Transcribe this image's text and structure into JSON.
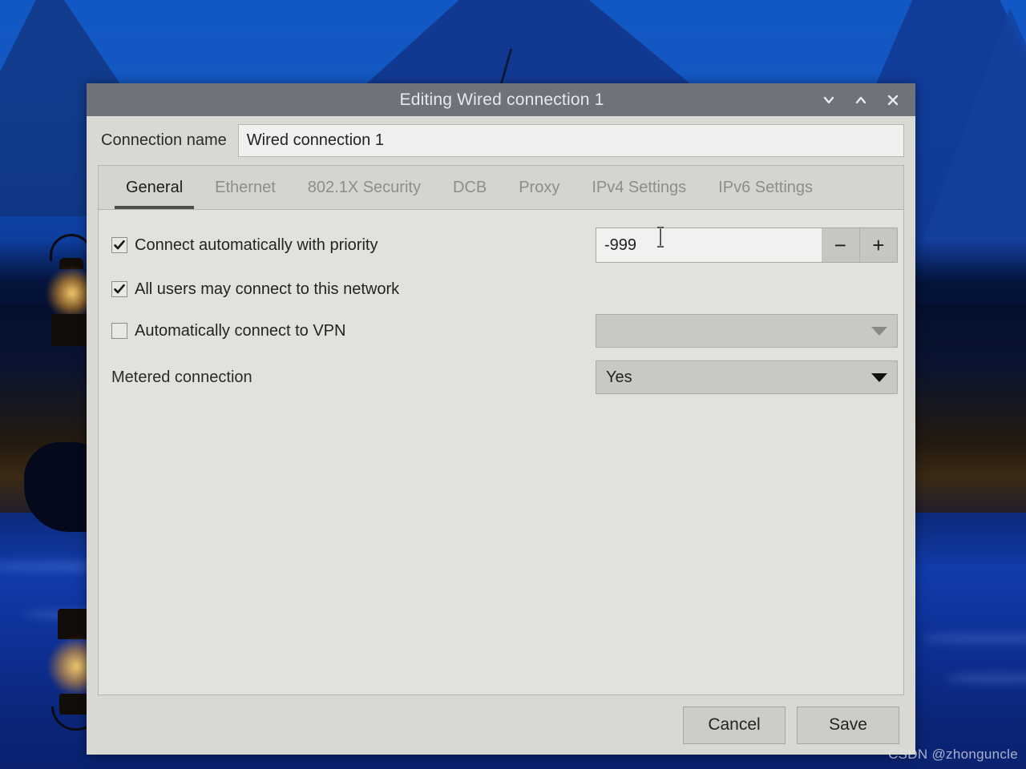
{
  "window": {
    "title": "Editing Wired connection 1",
    "controls": [
      {
        "name": "minimize",
        "glyph": "chevron-down"
      },
      {
        "name": "maximize",
        "glyph": "chevron-up"
      },
      {
        "name": "close",
        "glyph": "x"
      }
    ]
  },
  "connection": {
    "label": "Connection name",
    "value": "Wired connection 1",
    "placeholder": "Connection name"
  },
  "tabs": [
    {
      "label": "General",
      "active": true
    },
    {
      "label": "Ethernet",
      "active": false
    },
    {
      "label": "802.1X Security",
      "active": false
    },
    {
      "label": "DCB",
      "active": false
    },
    {
      "label": "Proxy",
      "active": false
    },
    {
      "label": "IPv4 Settings",
      "active": false
    },
    {
      "label": "IPv6 Settings",
      "active": false
    }
  ],
  "general": {
    "connect_auto": {
      "label": "Connect automatically with priority",
      "checked": true,
      "priority_value": "-999",
      "minus_label": "−",
      "plus_label": "+"
    },
    "all_users": {
      "label": "All users may connect to this network",
      "checked": true
    },
    "auto_vpn": {
      "label": "Automatically connect to VPN",
      "checked": false,
      "vpn_value": "",
      "vpn_enabled": false
    },
    "metered": {
      "label": "Metered connection",
      "value": "Yes"
    }
  },
  "footer": {
    "cancel_label": "Cancel",
    "save_label": "Save"
  },
  "watermark": {
    "text": "CSDN @zhonguncle"
  },
  "colors": {
    "titlebar": "#6e737b",
    "window_bg": "#d9d9d4",
    "panel_bg": "#e2e1dc",
    "tab_active_underline": "#4c4c4c",
    "desktop_blue": "#0d2a85",
    "lantern_glow": "#ffd46e"
  }
}
